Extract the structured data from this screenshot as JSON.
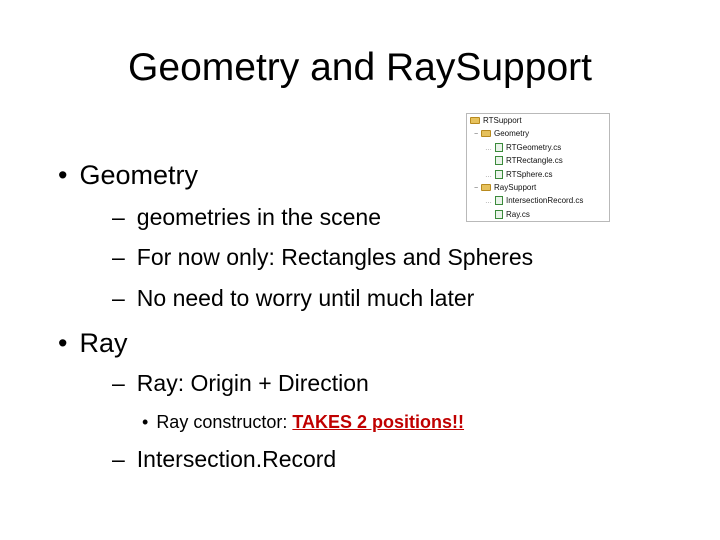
{
  "slide": {
    "title": "Geometry and RaySupport",
    "bullets": [
      {
        "marker": "•",
        "text": "Geometry"
      },
      {
        "marker": "–",
        "text": "geometries in the scene"
      },
      {
        "marker": "–",
        "text": "For now only: Rectangles and Spheres"
      },
      {
        "marker": "–",
        "text": "No need to worry until much later"
      },
      {
        "marker": "•",
        "text": "Ray"
      },
      {
        "marker": "–",
        "text": "Ray: Origin + Direction"
      },
      {
        "marker": "•",
        "text_prefix": "Ray constructor: ",
        "text_emphasis": "TAKES 2 positions!!"
      },
      {
        "marker": "–",
        "text": "Intersection.Record"
      }
    ],
    "emphasis_color": "#c00000"
  },
  "solution_tree": {
    "root": "RTSupport",
    "folders": [
      {
        "name": "Geometry",
        "files": [
          "RTGeometry.cs",
          "RTRectangle.cs",
          "RTSphere.cs"
        ]
      },
      {
        "name": "RaySupport",
        "files": [
          "IntersectionRecord.cs",
          "Ray.cs"
        ]
      }
    ]
  }
}
